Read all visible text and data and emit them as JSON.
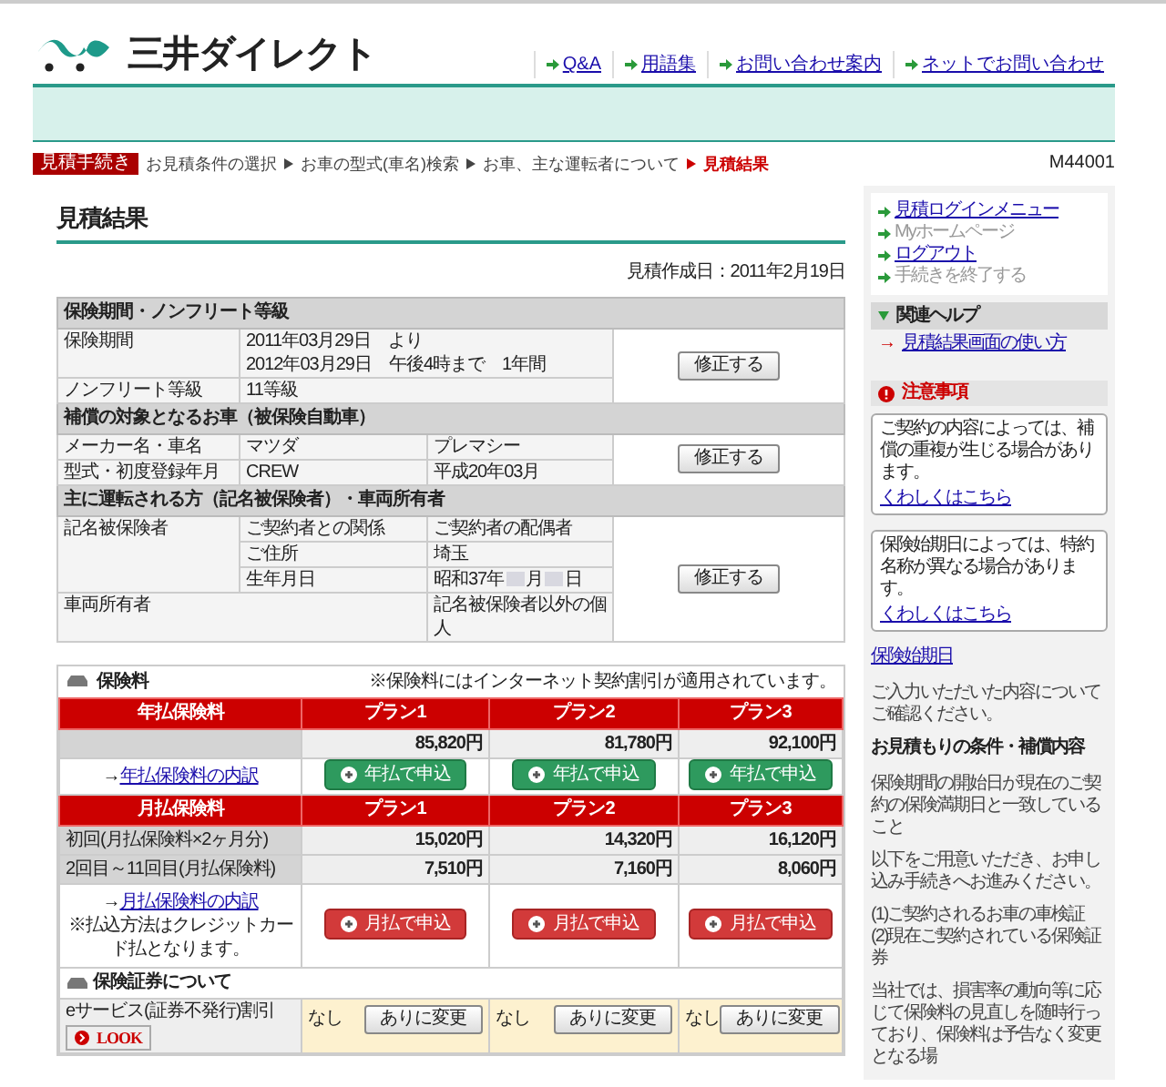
{
  "header": {
    "logo": "三井ダイレクト",
    "nav": [
      "Q&A",
      "用語集",
      "お問い合わせ案内",
      "ネットでお問い合わせ"
    ]
  },
  "breadcrumb": {
    "badge": "見積手続き",
    "steps": [
      {
        "label": "お見積条件の選択",
        "selected": false
      },
      {
        "label": "お車の型式(車名)検索",
        "selected": false
      },
      {
        "label": "お車、主な運転者について",
        "selected": false
      },
      {
        "label": "見積結果",
        "selected": true
      }
    ],
    "code": "M44001"
  },
  "page_title": "見積結果",
  "created": "見積作成日：2011年2月19日",
  "summary_sections": [
    {
      "heading": "保険期間・ノンフリート等級",
      "button": "修正する",
      "rows": [
        {
          "kind": "wide",
          "label": "保険期間",
          "lines": [
            "2011年03月29日　より",
            "2012年03月29日　午後4時まで　1年間"
          ]
        },
        {
          "kind": "wide",
          "label": "ノンフリート等級",
          "lines": [
            "11等級"
          ]
        }
      ]
    },
    {
      "heading": "補償の対象となるお車（被保険自動車）",
      "button": "修正する",
      "rows": [
        {
          "kind": "triple",
          "label": "メーカー名・車名",
          "value": "マツダ",
          "value2": "プレマシー"
        },
        {
          "kind": "triple",
          "label": "型式・初度登録年月",
          "value": "CREW",
          "value2": "平成20年03月"
        }
      ]
    },
    {
      "heading": "主に運転される方（記名被保険者）・車両所有者",
      "button": "修正する",
      "rows": [
        {
          "kind": "group",
          "label": "記名被保険者",
          "children": [
            {
              "label": "ご契約者との関係",
              "parts": [
                "ご契約者の配偶者"
              ]
            },
            {
              "label": "ご住所",
              "parts": [
                "埼玉"
              ]
            },
            {
              "label": "生年月日",
              "parts": [
                "昭和37年",
                "月",
                "日"
              ]
            }
          ]
        },
        {
          "kind": "widelabel",
          "label": "車両所有者",
          "value": "記名被保険者以外の個人"
        }
      ]
    }
  ],
  "premium": {
    "title": "保険料",
    "note": "※保険料にはインターネット契約割引が適用されています。",
    "blocks": [
      {
        "kind": "annual",
        "header": [
          "年払保険料",
          "プラン1",
          "プラン2",
          "プラン3"
        ],
        "rows": [
          {
            "label": "",
            "values": [
              "85,820円",
              "81,780円",
              "92,100円"
            ]
          }
        ],
        "arrow": "→",
        "link": "年払保険料の内訳",
        "buttons": [
          "年払で申込",
          "年払で申込",
          "年払で申込"
        ]
      },
      {
        "kind": "monthly",
        "header": [
          "月払保険料",
          "プラン1",
          "プラン2",
          "プラン3"
        ],
        "rows": [
          {
            "label": "初回(月払保険料×2ヶ月分)",
            "values": [
              "15,020円",
              "14,320円",
              "16,120円"
            ]
          },
          {
            "label": "2回目～11回目(月払保険料)",
            "values": [
              "7,510円",
              "7,160円",
              "8,060円"
            ]
          }
        ],
        "arrow": "→",
        "link": "月払保険料の内訳",
        "note": "※払込方法はクレジットカード払となります。",
        "buttons": [
          "月払で申込",
          "月払で申込",
          "月払で申込"
        ]
      }
    ],
    "policy": {
      "title": "保険証券について",
      "label": "eサービス(証券不発行)割引",
      "look": "LOOK",
      "options": [
        {
          "value": "なし",
          "button": "ありに変更"
        },
        {
          "value": "なし",
          "button": "ありに変更"
        },
        {
          "value": "なし",
          "button": "ありに変更"
        }
      ]
    }
  },
  "sidebar": {
    "menu": [
      {
        "label": "見積ログインメニュー",
        "disabled": false
      },
      {
        "label": "Myホームページ",
        "disabled": true
      },
      {
        "label": "ログアウト",
        "disabled": false
      },
      {
        "label": "手続きを終了する",
        "disabled": true
      }
    ],
    "help": {
      "heading": "関連ヘルプ",
      "arrow": "→",
      "link": "見積結果画面の使い方"
    },
    "notice": {
      "heading": "注意事項",
      "boxes": [
        {
          "text": "ご契約の内容によっては、補償の重複が生じる場合があります。",
          "link": "くわしくはこちら"
        },
        {
          "text": "保険始期日によっては、特約名称が異なる場合があります。",
          "link": "くわしくはこちら"
        }
      ]
    },
    "start_link": "保険始期日",
    "paragraphs": [
      {
        "kind": "text",
        "text": "ご入力いただいた内容についてご確認ください。"
      },
      {
        "kind": "heading",
        "text": "お見積もりの条件・補償内容"
      },
      {
        "kind": "text",
        "text": "保険期間の開始日が現在のご契約の保険満期日と一致していること"
      },
      {
        "kind": "text",
        "text": "以下をご用意いただき、お申し込み手続きへお進みください。"
      },
      {
        "kind": "lines",
        "lines": [
          "(1)ご契約されるお車の車検証",
          "(2)現在ご契約されている保険証券"
        ]
      },
      {
        "kind": "text",
        "text": "当社では、損害率の動向等に応じて保険料の見直しを随時行っており、保険料は予告なく変更となる場"
      }
    ]
  }
}
